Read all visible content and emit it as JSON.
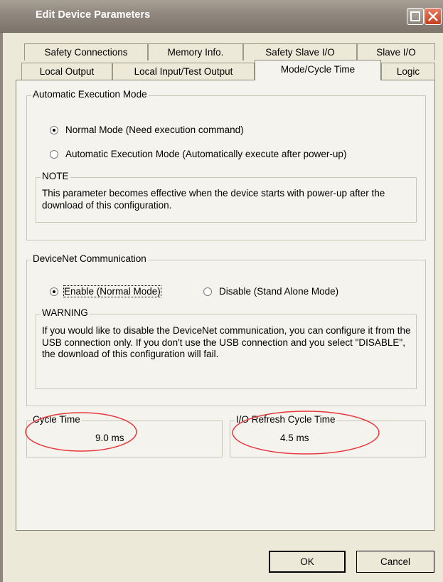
{
  "window": {
    "title": "Edit Device Parameters"
  },
  "tabs_row1": [
    "Safety Connections",
    "Memory Info.",
    "Safety Slave I/O",
    "Slave I/O"
  ],
  "tabs_row2": [
    "Local Output",
    "Local Input/Test Output",
    "Mode/Cycle Time",
    "Logic"
  ],
  "active_tab": "Mode/Cycle Time",
  "auto_exec": {
    "legend": "Automatic Execution Mode",
    "options": [
      "Normal Mode (Need execution command)",
      "Automatic Execution Mode (Automatically execute after power-up)"
    ],
    "selected": "Normal Mode (Need execution command)",
    "note_legend": "NOTE",
    "note_text": "This parameter becomes effective when the device starts with power-up after the download of this configuration."
  },
  "devicenet": {
    "legend": "DeviceNet Communication",
    "options": [
      "Enable (Normal Mode)",
      "Disable (Stand Alone Mode)"
    ],
    "selected": "Enable (Normal Mode)",
    "warning_legend": "WARNING",
    "warning_text": "If you would like to disable the DeviceNet communication, you can configure it from the USB connection only. If you don't use the USB connection and you select \"DISABLE\", the download of this configuration will fail."
  },
  "cycle_time": {
    "label": "Cycle Time",
    "value": "9.0 ms"
  },
  "io_refresh": {
    "label": "I/O Refresh Cycle Time",
    "value": "4.5 ms"
  },
  "buttons": {
    "ok": "OK",
    "cancel": "Cancel"
  },
  "colors": {
    "annotation_ellipse": "#e8373c"
  }
}
